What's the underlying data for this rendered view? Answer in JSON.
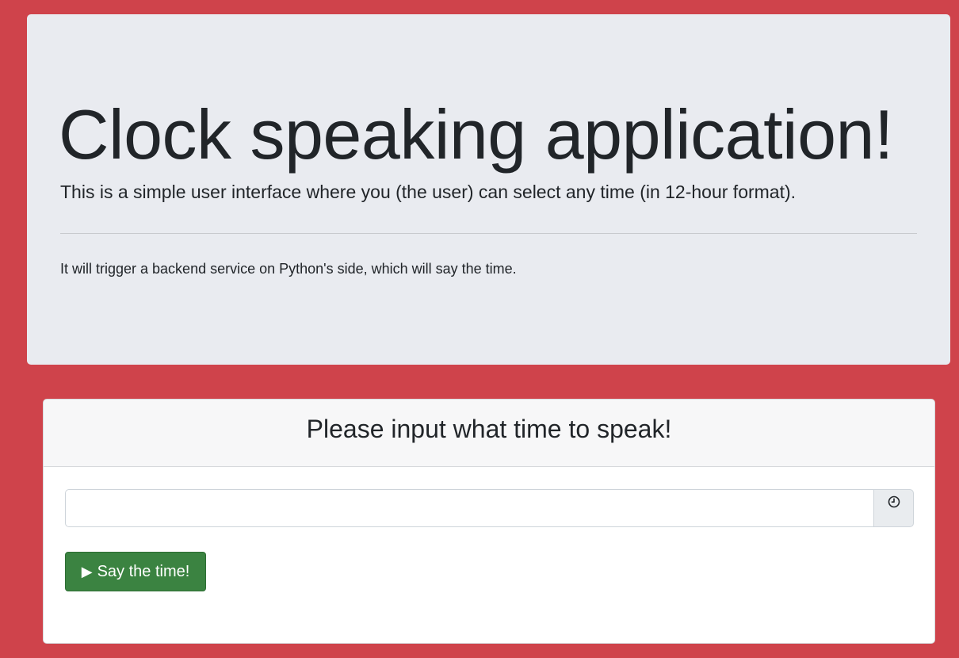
{
  "jumbotron": {
    "title": "Clock speaking application!",
    "lead": "This is a simple user interface where you (the user) can select any time (in 12-hour format).",
    "text": "It will trigger a backend service on Python's side, which will say the time."
  },
  "card": {
    "header": "Please input what time to speak!",
    "time_input": {
      "value": "",
      "placeholder": ""
    },
    "addon_icon": "clock-icon",
    "button": {
      "icon": "▶",
      "label": "Say the time!"
    }
  },
  "colors": {
    "background": "#cf434b",
    "jumbotron": "#e9ebf0",
    "button": "#3b8341"
  }
}
